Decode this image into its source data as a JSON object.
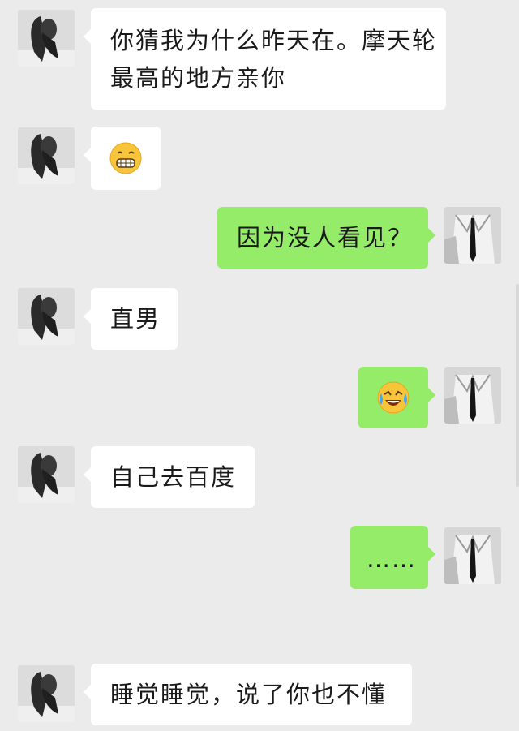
{
  "messages": [
    {
      "side": "in",
      "text": "你猜我为什么昨天在。摩天轮最高的地方亲你"
    },
    {
      "side": "in",
      "emoji": "grinning-face-emoji"
    },
    {
      "side": "out",
      "text": "因为没人看见？"
    },
    {
      "side": "in",
      "text": "直男"
    },
    {
      "side": "out",
      "emoji": "face-with-tears-of-joy-emoji"
    },
    {
      "side": "in",
      "text": "自己去百度"
    },
    {
      "side": "out",
      "text": "……"
    },
    {
      "side": "in",
      "text": "睡觉睡觉，说了你也不懂"
    }
  ],
  "colors": {
    "background": "#ebebeb",
    "incoming_bubble": "#ffffff",
    "outgoing_bubble": "#95ec69"
  },
  "icons": {
    "contact_avatar": "girl-avatar",
    "self_avatar": "man-in-tie-avatar"
  }
}
